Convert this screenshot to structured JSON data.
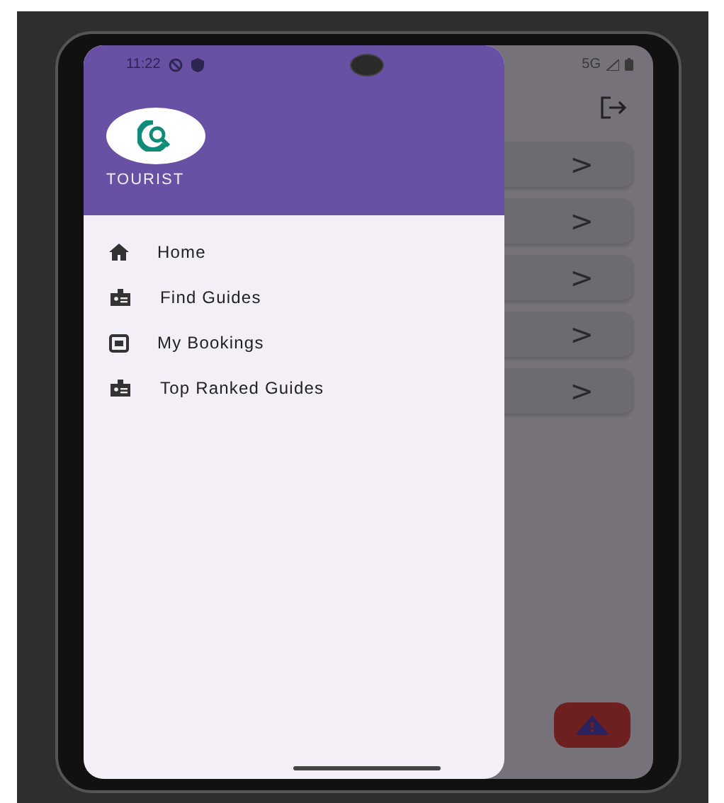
{
  "status_bar": {
    "time": "11:22",
    "network": "5G"
  },
  "drawer": {
    "header": {
      "title": "TOURIST"
    },
    "items": [
      {
        "label": "Home",
        "kind": "home"
      },
      {
        "label": "Find Guides",
        "kind": "badge"
      },
      {
        "label": "My Bookings",
        "kind": "box"
      },
      {
        "label": "Top Ranked Guides",
        "kind": "badge"
      }
    ]
  },
  "background_page": {
    "list_buttons": [
      ">",
      ">",
      ">",
      ">",
      ">"
    ]
  }
}
